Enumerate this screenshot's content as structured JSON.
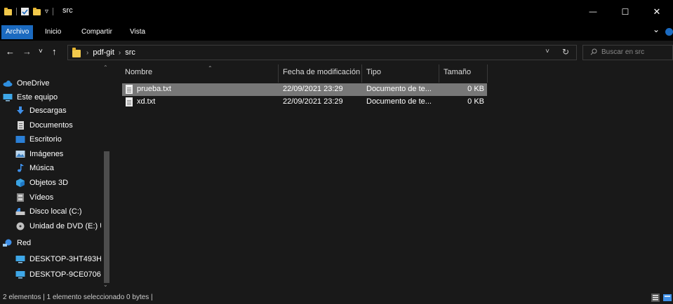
{
  "titlebar": {
    "title": "src",
    "quick_access_divider": "|",
    "dropdown_glyph": "▿",
    "minimize": "—",
    "maximize": "☐",
    "close": "✕"
  },
  "ribbon": {
    "tabs": [
      {
        "label": "Archivo",
        "active": true
      },
      {
        "label": "Inicio",
        "active": false
      },
      {
        "label": "Compartir",
        "active": false
      },
      {
        "label": "Vista",
        "active": false
      }
    ],
    "expand_glyph": "⌄"
  },
  "navigation": {
    "back": "←",
    "forward": "→",
    "recent": "˅",
    "up": "↑"
  },
  "address": {
    "crumbs": [
      "pdf-git",
      "src"
    ],
    "separator": "›",
    "dropdown": "˅",
    "refresh": "↻"
  },
  "search": {
    "placeholder": "Buscar en src"
  },
  "sidebar": {
    "items": [
      {
        "label": "OneDrive",
        "icon": "cloud-icon"
      },
      {
        "label": "Este equipo",
        "icon": "computer-icon"
      },
      {
        "label": "Descargas",
        "icon": "download-icon"
      },
      {
        "label": "Documentos",
        "icon": "document-icon"
      },
      {
        "label": "Escritorio",
        "icon": "desktop-icon"
      },
      {
        "label": "Imágenes",
        "icon": "pictures-icon"
      },
      {
        "label": "Música",
        "icon": "music-icon"
      },
      {
        "label": "Objetos 3D",
        "icon": "cube-icon"
      },
      {
        "label": "Vídeos",
        "icon": "film-icon"
      },
      {
        "label": "Disco local (C:)",
        "icon": "drive-icon"
      },
      {
        "label": "Unidad de DVD (E:) U",
        "icon": "dvd-icon"
      },
      {
        "label": "Red",
        "icon": "network-icon"
      },
      {
        "label": "DESKTOP-3HT493H",
        "icon": "computer-icon"
      },
      {
        "label": "DESKTOP-9CE0706",
        "icon": "computer-icon"
      }
    ]
  },
  "table": {
    "columns": [
      "Nombre",
      "Fecha de modificación",
      "Tipo",
      "Tamaño"
    ],
    "rows": [
      {
        "name": "prueba.txt",
        "modified": "22/09/2021 23:29",
        "type": "Documento de te...",
        "size": "0 KB",
        "selected": true
      },
      {
        "name": "xd.txt",
        "modified": "22/09/2021 23:29",
        "type": "Documento de te...",
        "size": "0 KB",
        "selected": false
      }
    ]
  },
  "status": {
    "text": "2 elementos  |  1 elemento seleccionado  0 bytes  |"
  },
  "colors": {
    "accent": "#1b6ac0",
    "background": "#191919",
    "selection": "#777777",
    "folder": "#f2c94c"
  }
}
